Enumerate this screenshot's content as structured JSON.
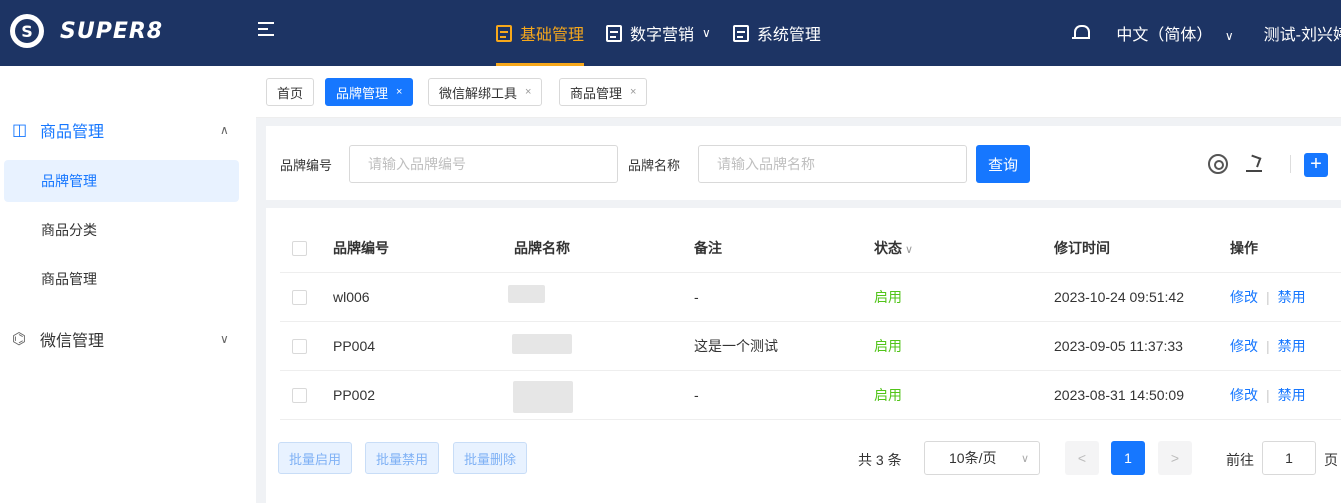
{
  "app": {
    "logo_text": "SUPER8",
    "logo_glyph": "S"
  },
  "topnav": {
    "items": [
      {
        "label": "基础管理",
        "icon": "document-icon",
        "active": true
      },
      {
        "label": "数字营销",
        "icon": "calculator-icon",
        "has_dropdown": true
      },
      {
        "label": "系统管理",
        "icon": "settings-window-icon"
      }
    ],
    "language": "中文（简体）",
    "language_chevron": "∨",
    "user": "测试-刘兴婷",
    "accent_color": "#f7a81b",
    "bg_color": "#1d3464"
  },
  "sidebar": {
    "groups": [
      {
        "label": "商品管理",
        "icon": "product-icon",
        "expanded": true,
        "chevron": "∧",
        "items": [
          {
            "label": "品牌管理",
            "active": true
          },
          {
            "label": "商品分类"
          },
          {
            "label": "商品管理"
          }
        ]
      },
      {
        "label": "微信管理",
        "icon": "wechat-icon",
        "expanded": false,
        "chevron": "∨"
      }
    ]
  },
  "tabs": [
    {
      "label": "首页",
      "closable": false
    },
    {
      "label": "品牌管理",
      "closable": true,
      "active": true
    },
    {
      "label": "微信解绑工具",
      "closable": true
    },
    {
      "label": "商品管理",
      "closable": true
    }
  ],
  "tab_close_glyph": "×",
  "search": {
    "brand_code_label": "品牌编号",
    "brand_code_placeholder": "请输入品牌编号",
    "brand_name_label": "品牌名称",
    "brand_name_placeholder": "请输入品牌名称",
    "query_button": "查询",
    "add_glyph": "+"
  },
  "table": {
    "columns": [
      "品牌编号",
      "品牌名称",
      "备注",
      "状态",
      "修订时间",
      "操作"
    ],
    "sort_glyph": "∨",
    "rows": [
      {
        "code": "wl006",
        "name": "",
        "remark": "-",
        "status": "启用",
        "updated": "2023-10-24 09:51:42",
        "edit": "修改",
        "disable": "禁用"
      },
      {
        "code": "PP004",
        "name": "",
        "remark": "这是一个测试",
        "status": "启用",
        "updated": "2023-09-05 11:37:33",
        "edit": "修改",
        "disable": "禁用"
      },
      {
        "code": "PP002",
        "name": "",
        "remark": "-",
        "status": "启用",
        "updated": "2023-08-31 14:50:09",
        "edit": "修改",
        "disable": "禁用"
      }
    ],
    "action_separator": "|"
  },
  "footer": {
    "bulk_enable": "批量启用",
    "bulk_disable": "批量禁用",
    "bulk_delete": "批量删除",
    "total": "共 3 条",
    "page_size": "10条/页",
    "page_size_chevron": "∨",
    "prev": "<",
    "current_page": "1",
    "next": ">",
    "goto_label": "前往",
    "goto_value": "1",
    "goto_suffix": "页"
  },
  "status_colors": {
    "enabled": "#52c41a",
    "link": "#1677ff"
  }
}
